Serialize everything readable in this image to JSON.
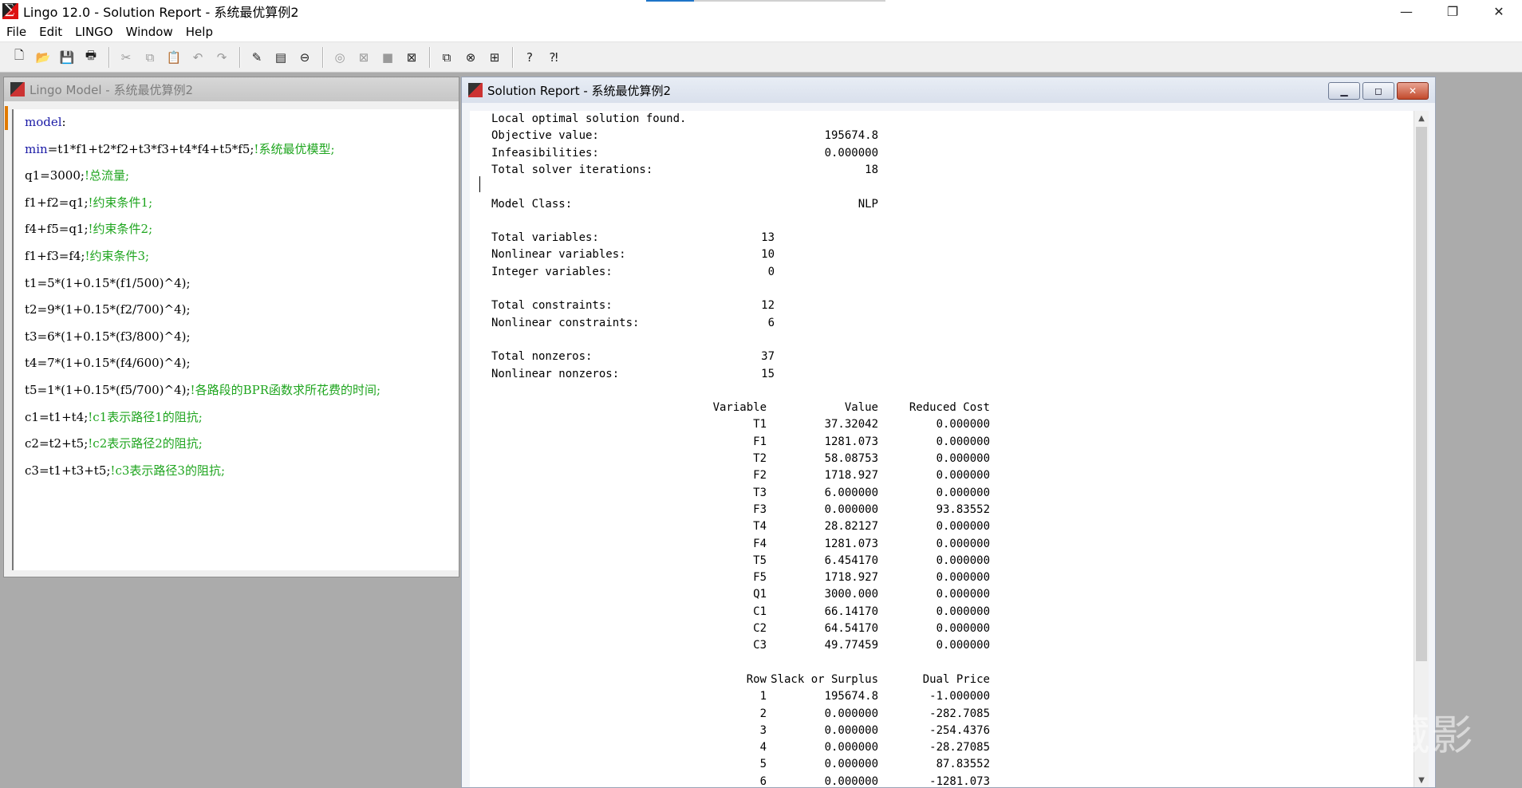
{
  "app": {
    "title": "Lingo 12.0 - Solution Report - 系统最优算例2",
    "minimize": "—",
    "restore": "❐",
    "close": "✕"
  },
  "menu": [
    "File",
    "Edit",
    "LINGO",
    "Window",
    "Help"
  ],
  "toolbar": {
    "groups": [
      [
        "new-file-icon",
        "open-file-icon",
        "save-icon",
        "print-icon"
      ],
      [
        "cut-icon",
        "copy-icon",
        "paste-icon",
        "undo-icon",
        "redo-icon"
      ],
      [
        "find-icon",
        "goto-line-icon",
        "match-paren-icon"
      ],
      [
        "solve-icon",
        "close-all-icon",
        "send-to-back-icon",
        "close-window-icon"
      ],
      [
        "tile-icon",
        "cascade-icon",
        "arrange-icon"
      ],
      [
        "help-icon",
        "context-help-icon"
      ]
    ],
    "glyphs": {
      "new-file-icon": "🗋",
      "open-file-icon": "📂",
      "save-icon": "💾",
      "print-icon": "🖶",
      "cut-icon": "✂",
      "copy-icon": "⧉",
      "paste-icon": "📋",
      "undo-icon": "↶",
      "redo-icon": "↷",
      "find-icon": "✎",
      "goto-line-icon": "▤",
      "match-paren-icon": "⊖",
      "solve-icon": "◎",
      "close-all-icon": "⊠",
      "send-to-back-icon": "■",
      "close-window-icon": "⊠",
      "tile-icon": "⧉",
      "cascade-icon": "⊗",
      "arrange-icon": "⊞",
      "help-icon": "?",
      "context-help-icon": "⁈"
    }
  },
  "model_window": {
    "title": "Lingo Model - 系统最优算例2",
    "lines": [
      {
        "code": "model:",
        "kw": true,
        "comment": ""
      },
      {
        "code": "min=t1*f1+t2*f2+t3*f3+t4*f4+t5*f5;",
        "kw": false,
        "kwpart": "min",
        "comment": "!系统最优模型;"
      },
      {
        "code": "q1=3000;",
        "comment": "!总流量;"
      },
      {
        "code": "f1+f2=q1;",
        "comment": "!约束条件1;"
      },
      {
        "code": "f4+f5=q1;",
        "comment": "!约束条件2;"
      },
      {
        "code": "f1+f3=f4;",
        "comment": "!约束条件3;"
      },
      {
        "code": "t1=5*(1+0.15*(f1/500)^4);",
        "comment": ""
      },
      {
        "code": "t2=9*(1+0.15*(f2/700)^4);",
        "comment": ""
      },
      {
        "code": "t3=6*(1+0.15*(f3/800)^4);",
        "comment": ""
      },
      {
        "code": "t4=7*(1+0.15*(f4/600)^4);",
        "comment": ""
      },
      {
        "code": "t5=1*(1+0.15*(f5/700)^4);",
        "comment": "!各路段的BPR函数求所花费的时间;"
      },
      {
        "code": "c1=t1+t4;",
        "comment": "!c1表示路径1的阻抗;"
      },
      {
        "code": "c2=t2+t5;",
        "comment": "!c2表示路径2的阻抗;"
      },
      {
        "code": "c3=t1+t3+t5;",
        "comment": "!c3表示路径3的阻抗;"
      }
    ]
  },
  "solution_window": {
    "title": "Solution Report - 系统最优算例2",
    "status": "Local optimal solution found.",
    "summary": [
      {
        "label": "Objective value:",
        "value": "195674.8",
        "col": "a"
      },
      {
        "label": "Infeasibilities:",
        "value": "0.000000",
        "col": "a"
      },
      {
        "label": "Total solver iterations:",
        "value": "18",
        "col": "a"
      },
      {
        "label": "",
        "value": "",
        "col": "a"
      },
      {
        "label": "Model Class:",
        "value": "NLP",
        "col": "a"
      },
      {
        "label": "",
        "value": "",
        "col": "a"
      },
      {
        "label": "Total variables:",
        "value": "13",
        "col": "b"
      },
      {
        "label": "Nonlinear variables:",
        "value": "10",
        "col": "b"
      },
      {
        "label": "Integer variables:",
        "value": "0",
        "col": "b"
      },
      {
        "label": "",
        "value": "",
        "col": "b"
      },
      {
        "label": "Total constraints:",
        "value": "12",
        "col": "b"
      },
      {
        "label": "Nonlinear constraints:",
        "value": "6",
        "col": "b"
      },
      {
        "label": "",
        "value": "",
        "col": "b"
      },
      {
        "label": "Total nonzeros:",
        "value": "37",
        "col": "b"
      },
      {
        "label": "Nonlinear nonzeros:",
        "value": "15",
        "col": "b"
      }
    ],
    "var_headers": [
      "Variable",
      "Value",
      "Reduced Cost"
    ],
    "variables": [
      [
        "T1",
        "37.32042",
        "0.000000"
      ],
      [
        "F1",
        "1281.073",
        "0.000000"
      ],
      [
        "T2",
        "58.08753",
        "0.000000"
      ],
      [
        "F2",
        "1718.927",
        "0.000000"
      ],
      [
        "T3",
        "6.000000",
        "0.000000"
      ],
      [
        "F3",
        "0.000000",
        "93.83552"
      ],
      [
        "T4",
        "28.82127",
        "0.000000"
      ],
      [
        "F4",
        "1281.073",
        "0.000000"
      ],
      [
        "T5",
        "6.454170",
        "0.000000"
      ],
      [
        "F5",
        "1718.927",
        "0.000000"
      ],
      [
        "Q1",
        "3000.000",
        "0.000000"
      ],
      [
        "C1",
        "66.14170",
        "0.000000"
      ],
      [
        "C2",
        "64.54170",
        "0.000000"
      ],
      [
        "C3",
        "49.77459",
        "0.000000"
      ]
    ],
    "row_headers": [
      "Row",
      "Slack or Surplus",
      "Dual Price"
    ],
    "rows": [
      [
        "1",
        "195674.8",
        "-1.000000"
      ],
      [
        "2",
        "0.000000",
        "-282.7085"
      ],
      [
        "3",
        "0.000000",
        "-254.4376"
      ],
      [
        "4",
        "0.000000",
        "-28.27085"
      ],
      [
        "5",
        "0.000000",
        "87.83552"
      ],
      [
        "6",
        "0.000000",
        "-1281.073"
      ]
    ]
  },
  "watermark": "知乎 @藏影"
}
